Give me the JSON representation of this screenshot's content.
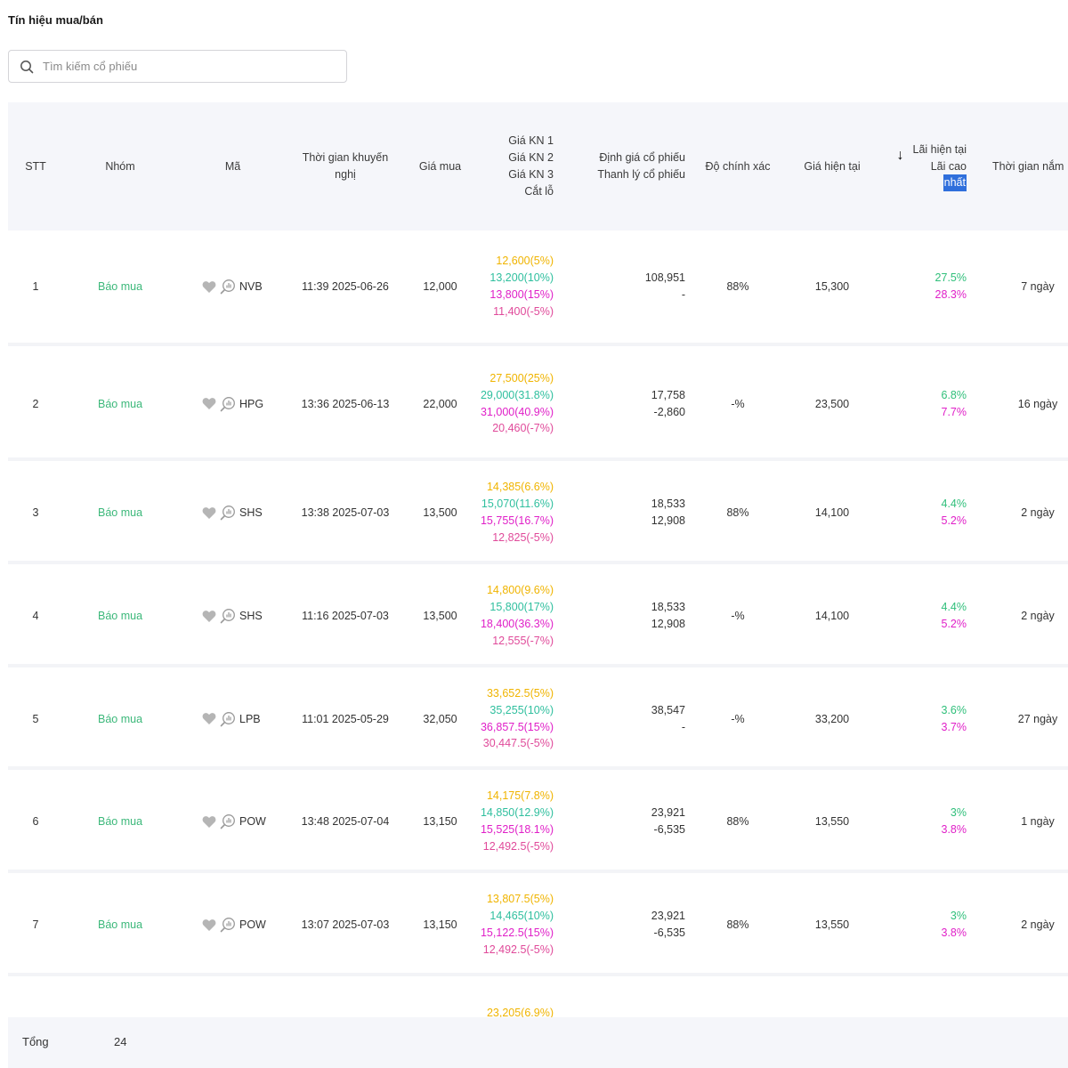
{
  "title": "Tín hiệu mua/bán",
  "search": {
    "placeholder": "Tìm kiếm cổ phiếu"
  },
  "columns": {
    "stt": "STT",
    "group": "Nhóm",
    "code": "Mã",
    "time_line1": "Thời gian khuyến",
    "time_line2": "nghị",
    "buy_price": "Giá mua",
    "targets_l1": "Giá KN 1",
    "targets_l2": "Giá KN 2",
    "targets_l3": "Giá KN 3",
    "targets_l4": "Cắt lỗ",
    "valuation_l1": "Định giá cổ phiếu",
    "valuation_l2": "Thanh lý cổ phiếu",
    "accuracy": "Độ chính xác",
    "current_price": "Giá hiện tại",
    "profit_l1": "Lãi hiện tại",
    "profit_l2": "Lãi cao",
    "profit_l3": "nhất",
    "hold_time": "Thời gian nắm"
  },
  "colors": {
    "group": "#3cb87a",
    "t1": "#f0b400",
    "t2": "#2fbf9e",
    "t3": "#e020c8",
    "stoploss": "#e04a9a",
    "profit_now": "#2fbf7a",
    "profit_max": "#e020c8",
    "header_bg": "#f5f6fa",
    "highlight": "#2f6fdc"
  },
  "rows": [
    {
      "stt": "1",
      "group": "Báo mua",
      "code": "NVB",
      "time": "11:39 2025-06-26",
      "buy": "12,000",
      "t1": "12,600(5%)",
      "t2": "13,200(10%)",
      "t3": "13,800(15%)",
      "sl": "11,400(-5%)",
      "val": "108,951",
      "liq": "-",
      "acc": "88%",
      "cur": "15,300",
      "pnow": "27.5%",
      "pmax": "28.3%",
      "hold": "7 ngày"
    },
    {
      "stt": "2",
      "group": "Báo mua",
      "code": "HPG",
      "time": "13:36 2025-06-13",
      "buy": "22,000",
      "t1": "27,500(25%)",
      "t2": "29,000(31.8%)",
      "t3": "31,000(40.9%)",
      "sl": "20,460(-7%)",
      "val": "17,758",
      "liq": "-2,860",
      "acc": "-%",
      "cur": "23,500",
      "pnow": "6.8%",
      "pmax": "7.7%",
      "hold": "16 ngày"
    },
    {
      "stt": "3",
      "group": "Báo mua",
      "code": "SHS",
      "time": "13:38 2025-07-03",
      "buy": "13,500",
      "t1": "14,385(6.6%)",
      "t2": "15,070(11.6%)",
      "t3": "15,755(16.7%)",
      "sl": "12,825(-5%)",
      "val": "18,533",
      "liq": "12,908",
      "acc": "88%",
      "cur": "14,100",
      "pnow": "4.4%",
      "pmax": "5.2%",
      "hold": "2 ngày"
    },
    {
      "stt": "4",
      "group": "Báo mua",
      "code": "SHS",
      "time": "11:16 2025-07-03",
      "buy": "13,500",
      "t1": "14,800(9.6%)",
      "t2": "15,800(17%)",
      "t3": "18,400(36.3%)",
      "sl": "12,555(-7%)",
      "val": "18,533",
      "liq": "12,908",
      "acc": "-%",
      "cur": "14,100",
      "pnow": "4.4%",
      "pmax": "5.2%",
      "hold": "2 ngày"
    },
    {
      "stt": "5",
      "group": "Báo mua",
      "code": "LPB",
      "time": "11:01 2025-05-29",
      "buy": "32,050",
      "t1": "33,652.5(5%)",
      "t2": "35,255(10%)",
      "t3": "36,857.5(15%)",
      "sl": "30,447.5(-5%)",
      "val": "38,547",
      "liq": "-",
      "acc": "-%",
      "cur": "33,200",
      "pnow": "3.6%",
      "pmax": "3.7%",
      "hold": "27 ngày"
    },
    {
      "stt": "6",
      "group": "Báo mua",
      "code": "POW",
      "time": "13:48 2025-07-04",
      "buy": "13,150",
      "t1": "14,175(7.8%)",
      "t2": "14,850(12.9%)",
      "t3": "15,525(18.1%)",
      "sl": "12,492.5(-5%)",
      "val": "23,921",
      "liq": "-6,535",
      "acc": "88%",
      "cur": "13,550",
      "pnow": "3%",
      "pmax": "3.8%",
      "hold": "1 ngày"
    },
    {
      "stt": "7",
      "group": "Báo mua",
      "code": "POW",
      "time": "13:07 2025-07-03",
      "buy": "13,150",
      "t1": "13,807.5(5%)",
      "t2": "14,465(10%)",
      "t3": "15,122.5(15%)",
      "sl": "12,492.5(-5%)",
      "val": "23,921",
      "liq": "-6,535",
      "acc": "88%",
      "cur": "13,550",
      "pnow": "3%",
      "pmax": "3.8%",
      "hold": "2 ngày"
    },
    {
      "stt": "",
      "group": "",
      "code": "",
      "time": "",
      "buy": "",
      "t1": "23,205(6.9%)",
      "t2": "",
      "t3": "",
      "sl": "",
      "val": "",
      "liq": "",
      "acc": "",
      "cur": "",
      "pnow": "",
      "pmax": "",
      "hold": ""
    }
  ],
  "footer": {
    "label": "Tổng",
    "count": "24"
  }
}
